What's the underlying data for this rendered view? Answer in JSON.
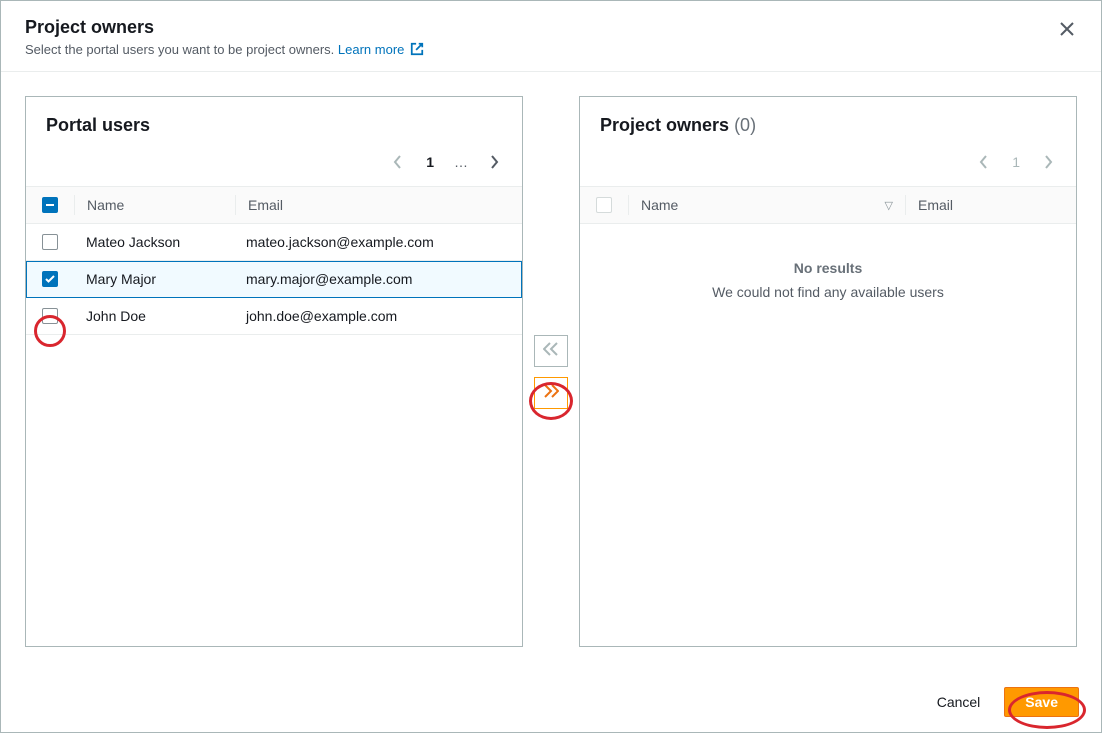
{
  "header": {
    "title": "Project owners",
    "subtitle": "Select the portal users you want to be project owners.",
    "learn_more": "Learn more"
  },
  "left_panel": {
    "title": "Portal users",
    "columns": {
      "name": "Name",
      "email": "Email"
    },
    "pagination": {
      "page": "1",
      "ellipsis": "…"
    },
    "header_checkbox_state": "indeterminate",
    "rows": [
      {
        "name": "Mateo Jackson",
        "email": "mateo.jackson@example.com",
        "checked": false
      },
      {
        "name": "Mary Major",
        "email": "mary.major@example.com",
        "checked": true
      },
      {
        "name": "John Doe",
        "email": "john.doe@example.com",
        "checked": false
      }
    ]
  },
  "right_panel": {
    "title": "Project owners",
    "count": "(0)",
    "columns": {
      "name": "Name",
      "email": "Email"
    },
    "pagination": {
      "page": "1"
    },
    "empty_title": "No results",
    "empty_message": "We could not find any available users"
  },
  "footer": {
    "cancel": "Cancel",
    "save": "Save"
  }
}
